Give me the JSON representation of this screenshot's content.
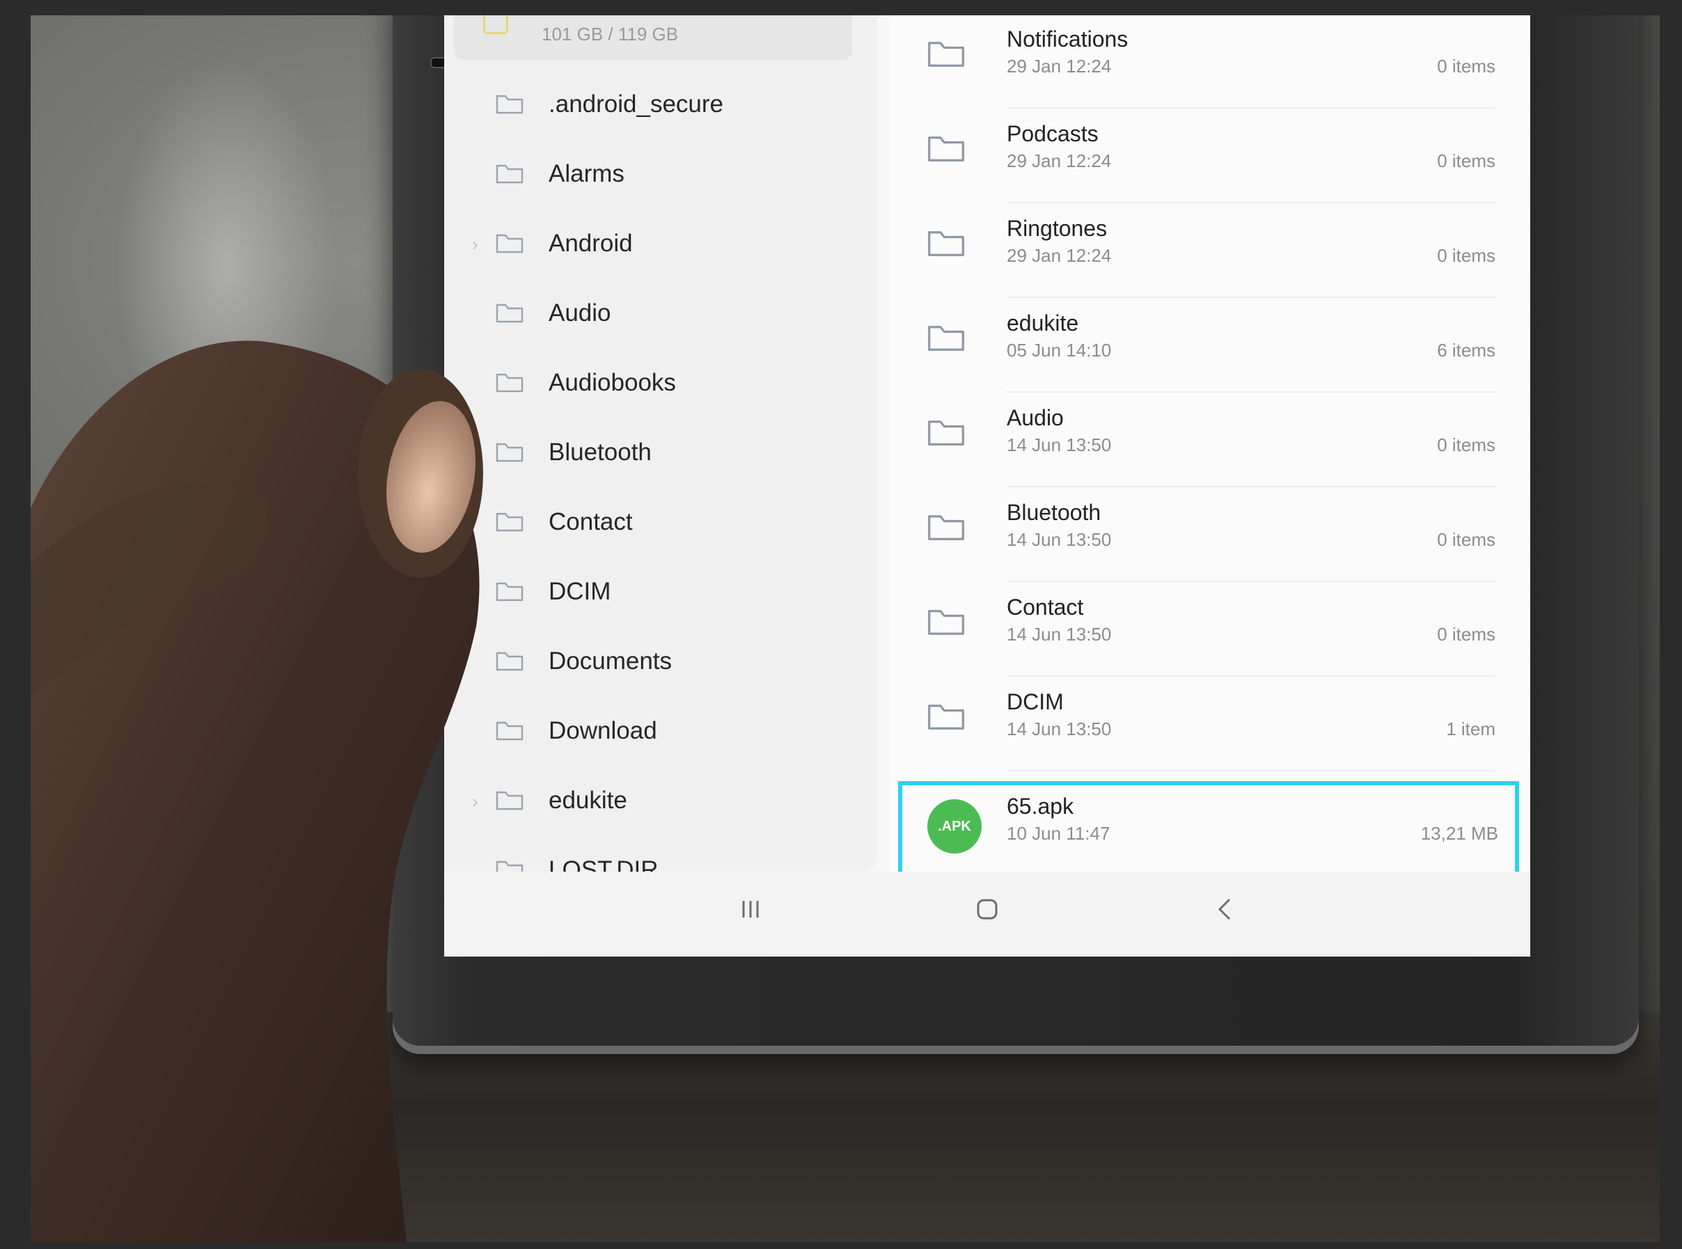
{
  "storage": {
    "usage": "101 GB / 119 GB"
  },
  "tree": [
    {
      "label": ".android_secure",
      "expandable": false
    },
    {
      "label": "Alarms",
      "expandable": false
    },
    {
      "label": "Android",
      "expandable": true
    },
    {
      "label": "Audio",
      "expandable": false
    },
    {
      "label": "Audiobooks",
      "expandable": false
    },
    {
      "label": "Bluetooth",
      "expandable": false
    },
    {
      "label": "Contact",
      "expandable": false
    },
    {
      "label": "DCIM",
      "expandable": false
    },
    {
      "label": "Documents",
      "expandable": false
    },
    {
      "label": "Download",
      "expandable": false
    },
    {
      "label": "edukite",
      "expandable": true
    },
    {
      "label": "LOST.DIR",
      "expandable": false
    }
  ],
  "files": [
    {
      "name": "Notifications",
      "date": "29 Jan 12:24",
      "meta": "0 items",
      "type": "folder"
    },
    {
      "name": "Podcasts",
      "date": "29 Jan 12:24",
      "meta": "0 items",
      "type": "folder"
    },
    {
      "name": "Ringtones",
      "date": "29 Jan 12:24",
      "meta": "0 items",
      "type": "folder"
    },
    {
      "name": "edukite",
      "date": "05 Jun 14:10",
      "meta": "6 items",
      "type": "folder"
    },
    {
      "name": "Audio",
      "date": "14 Jun 13:50",
      "meta": "0 items",
      "type": "folder"
    },
    {
      "name": "Bluetooth",
      "date": "14 Jun 13:50",
      "meta": "0 items",
      "type": "folder"
    },
    {
      "name": "Contact",
      "date": "14 Jun 13:50",
      "meta": "0 items",
      "type": "folder"
    },
    {
      "name": "DCIM",
      "date": "14 Jun 13:50",
      "meta": "1 item",
      "type": "folder"
    },
    {
      "name": "65.apk",
      "date": "10 Jun 11:47",
      "meta": "13,21 MB",
      "type": "apk",
      "badge": ".APK"
    }
  ],
  "colors": {
    "highlight": "#2fd0ee",
    "apk_badge": "#4cbb54"
  }
}
